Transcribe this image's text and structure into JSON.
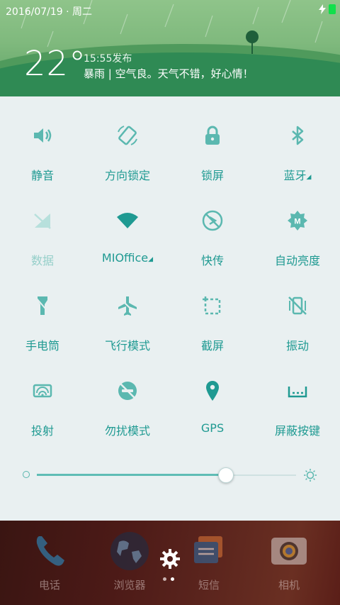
{
  "status_bar": {
    "date": "2016/07/19 · 周二",
    "charging_icon": "bolt-icon",
    "battery_color": "#11e04b"
  },
  "weather": {
    "temperature": "22°",
    "publish_time": "15:55发布",
    "description": "暴雨 | 空气良。天气不错，好心情！"
  },
  "quick_settings": [
    {
      "key": "mute",
      "label": "静音",
      "icon": "speaker-icon",
      "dropdown": false,
      "dim": false
    },
    {
      "key": "rotation-lock",
      "label": "方向锁定",
      "icon": "rotation-lock-icon",
      "dropdown": false,
      "dim": false
    },
    {
      "key": "lock-screen",
      "label": "锁屏",
      "icon": "padlock-icon",
      "dropdown": false,
      "dim": false
    },
    {
      "key": "bluetooth",
      "label": "蓝牙",
      "icon": "bluetooth-icon",
      "dropdown": true,
      "dim": false
    },
    {
      "key": "data",
      "label": "数据",
      "icon": "mobile-data-off-icon",
      "dropdown": false,
      "dim": true
    },
    {
      "key": "wifi",
      "label": "MIOffice",
      "icon": "wifi-icon",
      "dropdown": true,
      "dim": false
    },
    {
      "key": "quick-share",
      "label": "快传",
      "icon": "quick-share-off-icon",
      "dropdown": false,
      "dim": false
    },
    {
      "key": "auto-brightness",
      "label": "自动亮度",
      "icon": "auto-brightness-icon",
      "dropdown": false,
      "dim": false
    },
    {
      "key": "flashlight",
      "label": "手电筒",
      "icon": "flashlight-icon",
      "dropdown": false,
      "dim": false
    },
    {
      "key": "airplane-mode",
      "label": "飞行模式",
      "icon": "airplane-icon",
      "dropdown": false,
      "dim": false
    },
    {
      "key": "screenshot",
      "label": "截屏",
      "icon": "screenshot-icon",
      "dropdown": false,
      "dim": false
    },
    {
      "key": "vibrate",
      "label": "振动",
      "icon": "vibrate-off-icon",
      "dropdown": false,
      "dim": false
    },
    {
      "key": "cast",
      "label": "投射",
      "icon": "cast-icon",
      "dropdown": false,
      "dim": false
    },
    {
      "key": "do-not-disturb",
      "label": "勿扰模式",
      "icon": "do-not-disturb-icon",
      "dropdown": false,
      "dim": false
    },
    {
      "key": "gps",
      "label": "GPS",
      "icon": "location-pin-icon",
      "dropdown": false,
      "dim": false
    },
    {
      "key": "hide-keys",
      "label": "屏蔽按键",
      "icon": "keys-block-icon",
      "dropdown": false,
      "dim": false
    }
  ],
  "brightness": {
    "level_fraction": 0.73,
    "min_icon": "brightness-low-icon",
    "max_icon": "brightness-high-icon"
  },
  "dock": {
    "apps": [
      {
        "label": "电话",
        "icon": "phone-icon"
      },
      {
        "label": "浏览器",
        "icon": "globe-icon"
      },
      {
        "label": "短信",
        "icon": "message-icon"
      },
      {
        "label": "相机",
        "icon": "camera-icon"
      }
    ],
    "settings_icon": "gear-icon",
    "page_count": 2,
    "active_page": 1
  },
  "colors": {
    "accent": "#1f9a92",
    "accent_dim": "#95cfc9",
    "panel_bg": "#e9f0f1",
    "header_green": "#2f8a54"
  }
}
